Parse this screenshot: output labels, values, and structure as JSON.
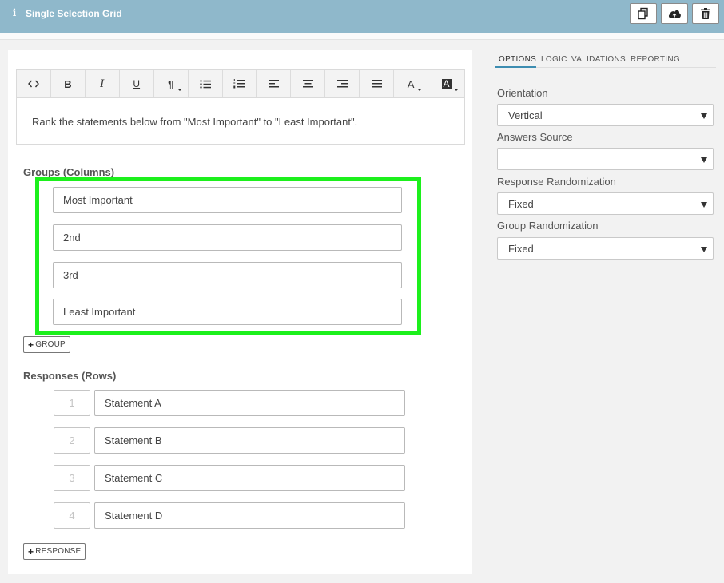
{
  "header": {
    "title": "Single Selection Grid",
    "info_icon": "info-icon",
    "actions": [
      {
        "name": "copy",
        "icon": "copy-icon"
      },
      {
        "name": "upload",
        "icon": "cloud-upload-icon"
      },
      {
        "name": "delete",
        "icon": "trash-icon"
      }
    ]
  },
  "toolbar": {
    "buttons": [
      {
        "name": "code",
        "label": "<>"
      },
      {
        "name": "bold",
        "label": "B"
      },
      {
        "name": "italic",
        "label": "I"
      },
      {
        "name": "underline",
        "label": "U"
      },
      {
        "name": "paragraph",
        "label": "¶"
      },
      {
        "name": "bulleted-list",
        "icon": "bulleted-list-icon"
      },
      {
        "name": "numbered-list",
        "icon": "numbered-list-icon"
      },
      {
        "name": "align-left",
        "icon": "align-left-icon"
      },
      {
        "name": "align-center",
        "icon": "align-center-icon"
      },
      {
        "name": "align-right",
        "icon": "align-right-icon"
      },
      {
        "name": "justify",
        "icon": "justify-icon"
      },
      {
        "name": "font-color",
        "label": "A"
      },
      {
        "name": "background-color",
        "label": "A"
      }
    ]
  },
  "question_text": "Rank the statements below from \"Most Important\" to \"Least Important\".",
  "groups": {
    "label": "Groups (Columns)",
    "items": [
      "Most Important",
      "2nd",
      "3rd",
      "Least Important"
    ],
    "add_button": "GROUP"
  },
  "responses": {
    "label": "Responses (Rows)",
    "items": [
      {
        "number": "1",
        "text": "Statement A"
      },
      {
        "number": "2",
        "text": "Statement B"
      },
      {
        "number": "3",
        "text": "Statement C"
      },
      {
        "number": "4",
        "text": "Statement D"
      }
    ],
    "add_button": "RESPONSE"
  },
  "side_panel": {
    "tabs": [
      "OPTIONS",
      "LOGIC",
      "VALIDATIONS",
      "REPORTING"
    ],
    "active_tab": "OPTIONS",
    "fields": [
      {
        "label": "Orientation",
        "value": "Vertical"
      },
      {
        "label": "Answers Source",
        "value": ""
      },
      {
        "label": "Response Randomization",
        "value": "Fixed"
      },
      {
        "label": "Group Randomization",
        "value": "Fixed"
      }
    ]
  },
  "colors": {
    "header_bg": "#8fb8cb",
    "highlight": "#1cf01c",
    "tab_accent": "#3d8db1"
  }
}
